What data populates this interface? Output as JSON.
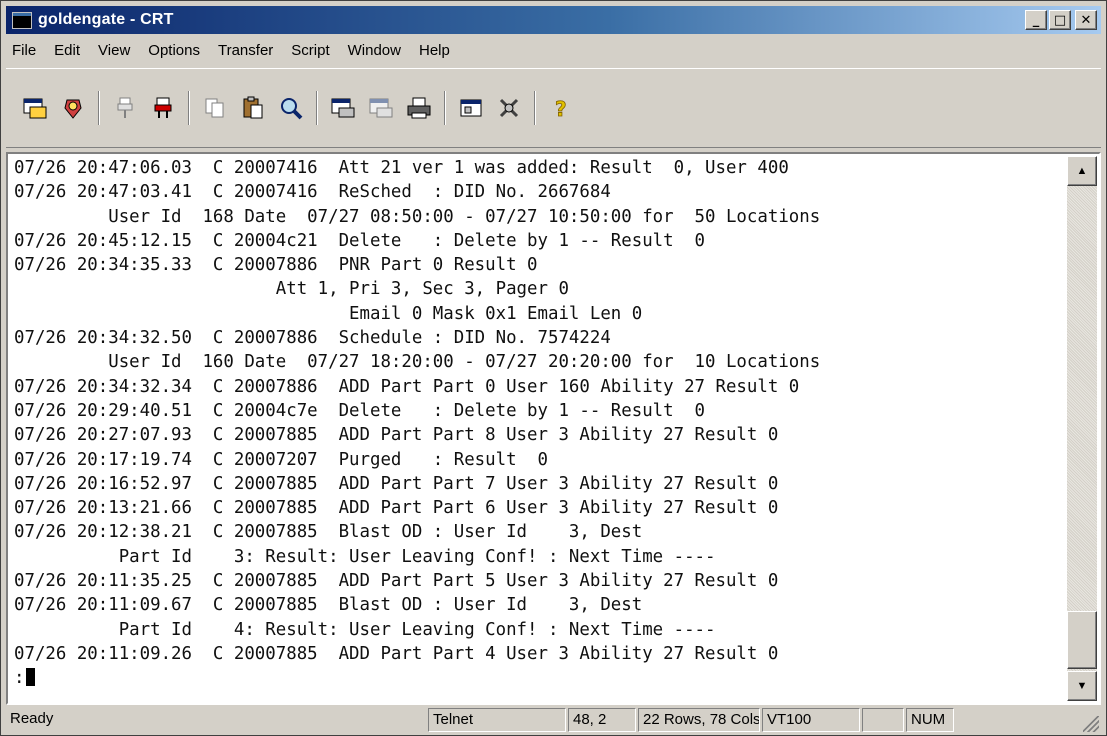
{
  "window": {
    "title": "goldengate - CRT",
    "minimize_label": "_",
    "maximize_label": "□",
    "close_label": "✕"
  },
  "menu": [
    {
      "label": "File"
    },
    {
      "label": "Edit"
    },
    {
      "label": "View"
    },
    {
      "label": "Options"
    },
    {
      "label": "Transfer"
    },
    {
      "label": "Script"
    },
    {
      "label": "Window"
    },
    {
      "label": "Help"
    }
  ],
  "toolbar": {
    "icons": [
      "connect-icon",
      "quick-connect-icon",
      "disconnect-icon",
      "reconnect-icon",
      "copy-icon",
      "paste-icon",
      "find-icon",
      "print-screen-icon",
      "print-selection-icon",
      "print-icon",
      "session-options-icon",
      "global-options-icon",
      "help-icon"
    ]
  },
  "terminal": {
    "lines": [
      "07/26 20:47:06.03  C 20007416  Att 21 ver 1 was added: Result  0, User 400",
      "07/26 20:47:03.41  C 20007416  ReSched  : DID No. 2667684",
      "         User Id  168 Date  07/27 08:50:00 - 07/27 10:50:00 for  50 Locations",
      "07/26 20:45:12.15  C 20004c21  Delete   : Delete by 1 -- Result  0",
      "07/26 20:34:35.33  C 20007886  PNR Part 0 Result 0",
      "                         Att 1, Pri 3, Sec 3, Pager 0",
      "                                Email 0 Mask 0x1 Email Len 0",
      "07/26 20:34:32.50  C 20007886  Schedule : DID No. 7574224",
      "         User Id  160 Date  07/27 18:20:00 - 07/27 20:20:00 for  10 Locations",
      "07/26 20:34:32.34  C 20007886  ADD Part Part 0 User 160 Ability 27 Result 0",
      "07/26 20:29:40.51  C 20004c7e  Delete   : Delete by 1 -- Result  0",
      "07/26 20:27:07.93  C 20007885  ADD Part Part 8 User 3 Ability 27 Result 0",
      "07/26 20:17:19.74  C 20007207  Purged   : Result  0",
      "07/26 20:16:52.97  C 20007885  ADD Part Part 7 User 3 Ability 27 Result 0",
      "07/26 20:13:21.66  C 20007885  ADD Part Part 6 User 3 Ability 27 Result 0",
      "07/26 20:12:38.21  C 20007885  Blast OD : User Id    3, Dest",
      "          Part Id    3: Result: User Leaving Conf! : Next Time ----",
      "07/26 20:11:35.25  C 20007885  ADD Part Part 5 User 3 Ability 27 Result 0",
      "07/26 20:11:09.67  C 20007885  Blast OD : User Id    3, Dest",
      "          Part Id    4: Result: User Leaving Conf! : Next Time ----",
      "07/26 20:11:09.26  C 20007885  ADD Part Part 4 User 3 Ability 27 Result 0"
    ],
    "prompt": ":"
  },
  "status": {
    "ready": "Ready",
    "protocol": "Telnet",
    "cursor_pos": "48,  2",
    "dimensions": "22 Rows, 78 Cols",
    "emulation": "VT100",
    "blank": "",
    "num": "NUM"
  }
}
